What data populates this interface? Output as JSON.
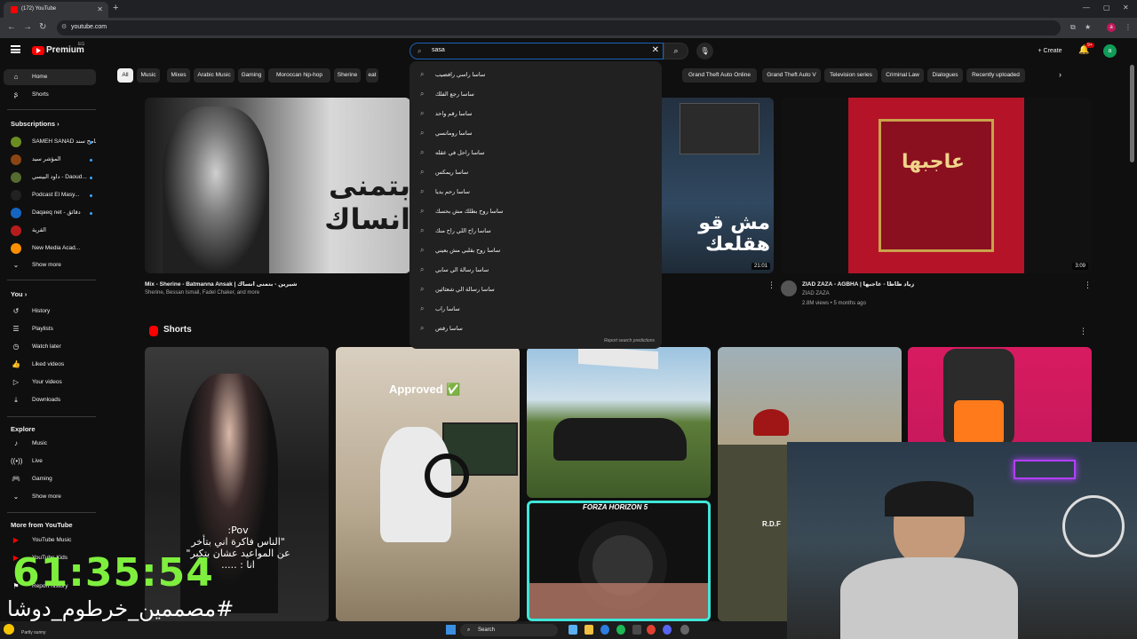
{
  "browser": {
    "tab_title": "(172) YouTube",
    "url": "youtube.com"
  },
  "header": {
    "logo_text": "Premium",
    "logo_country": "EG",
    "search_value": "sasa",
    "create_label": "Create",
    "notification_count": "9+",
    "avatar_letter": "a"
  },
  "chips": [
    "All",
    "Music",
    "Mixes",
    "Arabic Music",
    "Gaming",
    "Moroccan hip-hop",
    "Sherine",
    "eat",
    "Grand Theft Auto Online",
    "Grand Theft Auto V",
    "Television series",
    "Criminal Law",
    "Dialogues",
    "Recently uploaded"
  ],
  "sidebar": {
    "home": "Home",
    "shorts": "Shorts",
    "subscriptions_heading": "Subscriptions",
    "subscriptions": [
      {
        "label": "SAMEH SANAD سامح سند",
        "color": "#6b8e23"
      },
      {
        "label": "المؤشر سيد",
        "color": "#8b4513"
      },
      {
        "label": "داود البيسي - Daoud...",
        "color": "#556b2f"
      },
      {
        "label": "Podcast El Masy...",
        "color": "#222"
      },
      {
        "label": "Daqaeq net - دقائق",
        "color": "#1565c0"
      },
      {
        "label": "القرية",
        "color": "#b71c1c"
      },
      {
        "label": "New Media Acad...",
        "color": "#ff8f00"
      }
    ],
    "show_more": "Show more",
    "you_heading": "You",
    "you_items": [
      {
        "label": "History",
        "icon": "history-icon"
      },
      {
        "label": "Playlists",
        "icon": "playlists-icon"
      },
      {
        "label": "Watch later",
        "icon": "watch-later-icon"
      },
      {
        "label": "Liked videos",
        "icon": "liked-icon"
      },
      {
        "label": "Your videos",
        "icon": "your-videos-icon"
      },
      {
        "label": "Downloads",
        "icon": "downloads-icon"
      }
    ],
    "explore_heading": "Explore",
    "explore_items": [
      {
        "label": "Music",
        "icon": "music-icon"
      },
      {
        "label": "Live",
        "icon": "live-icon"
      },
      {
        "label": "Gaming",
        "icon": "gaming-icon"
      }
    ],
    "explore_show_more": "Show more",
    "more_heading": "More from YouTube",
    "more_items": [
      {
        "label": "YouTube Music"
      },
      {
        "label": "YouTube Kids"
      }
    ],
    "report_history": "Report history"
  },
  "videos": [
    {
      "title": "Mix - Sherine - Batmanna Ansak | شيرين - بتمنى انساك",
      "sub": "Sherine, Bessan Ismail, Fadel Chaker, and more",
      "thumb_text": "بتمنى انساك"
    },
    {
      "title": "",
      "sub": "",
      "duration": "21:01",
      "thumb_text": "مش قو هقلعك"
    },
    {
      "title": "ZIAD ZAZA - AGBHA | زياد ظاظا - عاجبها",
      "channel": "ZIAD ZAZA",
      "meta": "2.8M views • 5 months ago",
      "duration": "3:09",
      "thumb_text": "عاجبها"
    }
  ],
  "suggestions": [
    "ساسا راسي رافضيب",
    "ساسا رجع الفلك",
    "ساسا رقم واحد",
    "ساسا رومانسي",
    "ساسا راحل في عقله",
    "ساسا ريمكس",
    "ساسا رحم يديا",
    "ساسا روح بطلك مش بحسك",
    "ساسا راح اللي راح منك",
    "ساسا روح بقلبي مش بعيني",
    "ساسا رسالة الي سابي",
    "ساسا رسالة الي شعثائين",
    "ساسا راب",
    "ساسا رقص"
  ],
  "report_predictions": "Report search predictions",
  "shorts": {
    "heading": "Shorts",
    "items": [
      {
        "overlay": "Pov:\n\"الناس فاكرة اني بتأخر\nعن المواعيد عشان بتكبر\"\nانا : ....."
      },
      {
        "overlay": "Approved ✅"
      },
      {
        "overlay": "FORZA HORIZON 5"
      },
      {
        "overlay": "R.D.F"
      },
      {
        "overlay": ""
      }
    ]
  },
  "stream_overlay": {
    "timer": "61:35:54",
    "hashtag": "#مصممين_خرطوم_دوشا"
  },
  "taskbar": {
    "search_label": "Search",
    "weather": "Partly sunny"
  },
  "colors": {
    "accent_red": "#ff0000",
    "timer_green": "#7fef3e",
    "search_border": "#1c62b9"
  }
}
